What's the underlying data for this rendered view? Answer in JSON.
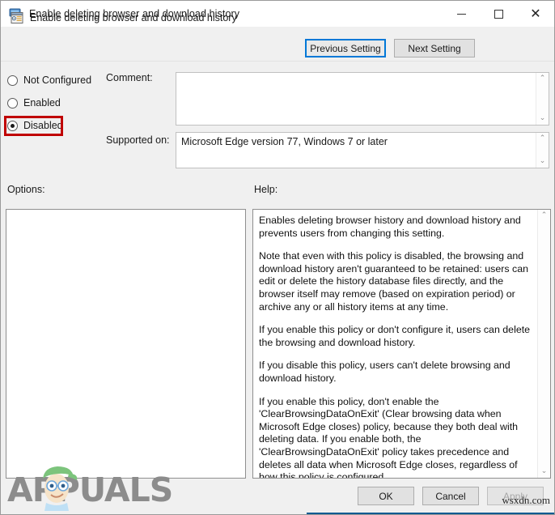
{
  "window": {
    "title": "Enable deleting browser and download history",
    "title_icon": "monitor-policy-icon",
    "minimize_label": "Minimize",
    "maximize_label": "Maximize",
    "close_label": "Close"
  },
  "header": {
    "icon": "policy-setting-icon",
    "title": "Enable deleting browser and download history",
    "previous_button": "Previous Setting",
    "next_button": "Next Setting"
  },
  "state": {
    "options": [
      {
        "id": "not-configured",
        "label": "Not Configured",
        "selected": false
      },
      {
        "id": "enabled",
        "label": "Enabled",
        "selected": false
      },
      {
        "id": "disabled",
        "label": "Disabled",
        "selected": true
      }
    ],
    "highlight_color": "#c00000",
    "accent_color": "#0078d7"
  },
  "comment": {
    "label": "Comment:",
    "value": "",
    "placeholder": ""
  },
  "supported": {
    "label": "Supported on:",
    "value": "Microsoft Edge version 77, Windows 7 or later"
  },
  "options_panel": {
    "label": "Options:",
    "content": ""
  },
  "help_panel": {
    "label": "Help:",
    "paragraphs": [
      "Enables deleting browser history and download history and prevents users from changing this setting.",
      "Note that even with this policy is disabled, the browsing and download history aren't guaranteed to be retained: users can edit or delete the history database files directly, and the browser itself may remove (based on expiration period) or archive any or all history items at any time.",
      "If you enable this policy or don't configure it, users can delete the browsing and download history.",
      "If you disable this policy, users can't delete browsing and download history.",
      "If you enable this policy, don't enable the 'ClearBrowsingDataOnExit' (Clear browsing data when Microsoft Edge closes) policy, because they both deal with deleting data. If you enable both, the 'ClearBrowsingDataOnExit' policy takes precedence and deletes all data when Microsoft Edge closes, regardless of how this policy is configured."
    ]
  },
  "footer": {
    "ok_label": "OK",
    "cancel_label": "Cancel",
    "apply_label": "Apply",
    "apply_disabled": true
  },
  "watermarks": {
    "brand": "APPUALS",
    "site": "wsxdn.com"
  },
  "scrollbar": {
    "up_arrow": "⌃",
    "down_arrow": "⌄"
  }
}
